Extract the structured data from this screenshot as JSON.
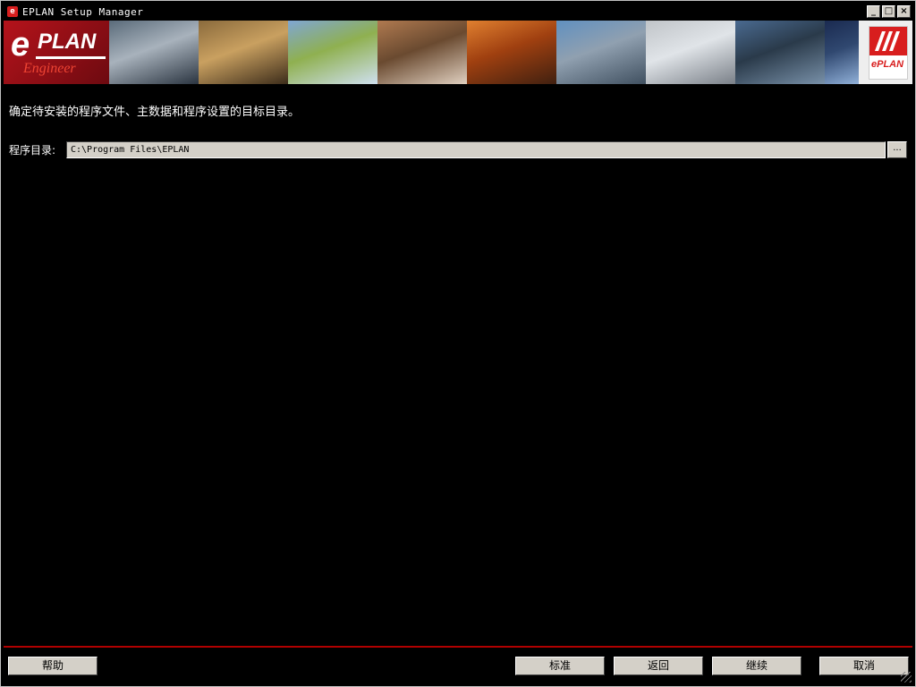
{
  "window": {
    "title": "EPLAN Setup Manager",
    "app_icon_glyph": "e",
    "minimize_glyph": "_",
    "maximize_glyph": "□",
    "close_glyph": "×"
  },
  "banner": {
    "logo_e": "e",
    "logo_plan": "PLAN",
    "logo_sub": "Engineer",
    "brand_text": "ePLAN",
    "photos": [
      {
        "name": "banner-photo-car-factory",
        "colors": [
          "#5a6b7a",
          "#2a3440",
          "#a8b2bc"
        ]
      },
      {
        "name": "banner-photo-warehouse",
        "colors": [
          "#8a6a3c",
          "#3c2c1a",
          "#c9a060"
        ]
      },
      {
        "name": "banner-photo-wind-turbines",
        "colors": [
          "#7fa6d4",
          "#cfe0f0",
          "#8fb050"
        ]
      },
      {
        "name": "banner-photo-machine",
        "colors": [
          "#b07a50",
          "#e0d0c0",
          "#6a4a30"
        ]
      },
      {
        "name": "banner-photo-oil-pumps",
        "colors": [
          "#e08030",
          "#402010",
          "#a04010"
        ]
      },
      {
        "name": "banner-photo-refinery",
        "colors": [
          "#6090c0",
          "#405060",
          "#90a0b0"
        ]
      },
      {
        "name": "banner-photo-assembly-line",
        "colors": [
          "#c0c4c8",
          "#7a8088",
          "#e0e4e8"
        ]
      },
      {
        "name": "banner-photo-substation",
        "colors": [
          "#4a6a90",
          "#7890a8",
          "#2a3a4a"
        ]
      },
      {
        "name": "banner-photo-solar-panels",
        "colors": [
          "#1a2a50",
          "#90b0d8",
          "#304870"
        ]
      }
    ]
  },
  "main": {
    "instruction": "确定待安装的程序文件、主数据和程序设置的目标目录。",
    "dir_label": "程序目录:",
    "dir_value": "C:\\Program Files\\EPLAN",
    "browse_label": "..."
  },
  "footer": {
    "help": "帮助",
    "standard": "标准",
    "back": "返回",
    "continue": "继续",
    "cancel": "取消"
  },
  "colors": {
    "accent_red": "#b00000",
    "brand_red": "#d81e1e",
    "button_face": "#d4d0c8"
  }
}
